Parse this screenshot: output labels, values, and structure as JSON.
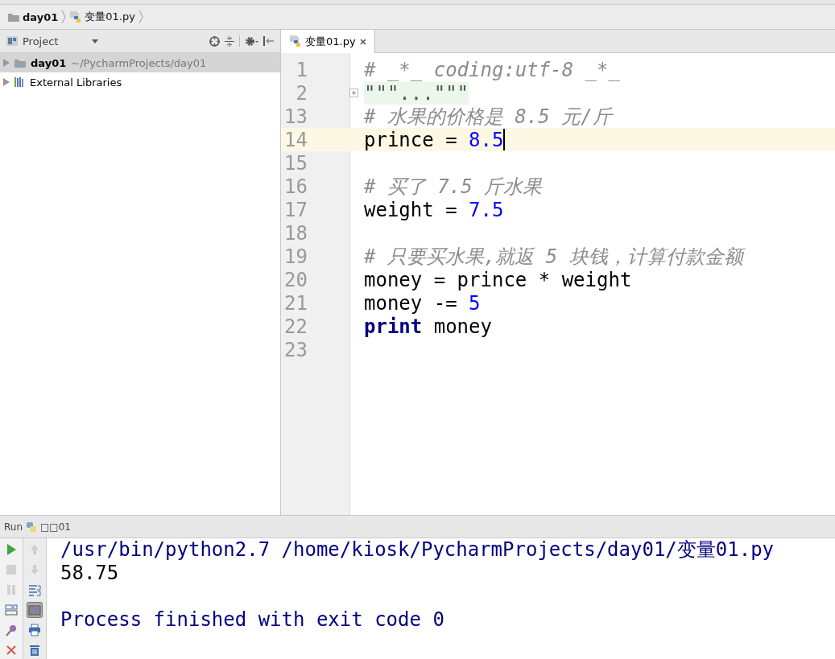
{
  "breadcrumb": [
    {
      "label": "day01",
      "kind": "folder"
    },
    {
      "label": "变量01.py",
      "kind": "python"
    }
  ],
  "project_panel": {
    "title": "Project",
    "tree": [
      {
        "label": "day01",
        "path": "~/PycharmProjects/day01",
        "kind": "folder",
        "selected": true,
        "expanded": false
      },
      {
        "label": "External Libraries",
        "kind": "library",
        "selected": false,
        "expanded": false
      }
    ]
  },
  "editor": {
    "tabs": [
      {
        "label": "变量01.py",
        "selected": true
      }
    ],
    "lines": [
      {
        "number": "1",
        "current": false,
        "tokens": [
          {
            "kind": "comment",
            "text": "# _*_ coding:utf-8 _*_"
          }
        ]
      },
      {
        "number": "2",
        "current": false,
        "folded": true,
        "tokens": [
          {
            "kind": "folded",
            "text": "\"\"\"...\"\"\""
          }
        ]
      },
      {
        "number": "13",
        "current": false,
        "tokens": [
          {
            "kind": "comment",
            "text": "# 水果的价格是 8.5 元/斤"
          }
        ]
      },
      {
        "number": "14",
        "current": true,
        "tokens": [
          {
            "kind": "plain",
            "text": "prince = "
          },
          {
            "kind": "number",
            "text": "8.5"
          }
        ]
      },
      {
        "number": "15",
        "current": false
      },
      {
        "number": "16",
        "current": false,
        "tokens": [
          {
            "kind": "comment",
            "text": "# 买了 7.5 斤水果"
          }
        ]
      },
      {
        "number": "17",
        "current": false,
        "tokens": [
          {
            "kind": "plain",
            "text": "weight = "
          },
          {
            "kind": "number",
            "text": "7.5"
          }
        ]
      },
      {
        "number": "18",
        "current": false
      },
      {
        "number": "19",
        "current": false,
        "tokens": [
          {
            "kind": "comment",
            "text": "# 只要买水果,就返 5 块钱，计算付款金额"
          }
        ]
      },
      {
        "number": "20",
        "current": false,
        "tokens": [
          {
            "kind": "plain",
            "text": "money = prince * weight"
          }
        ]
      },
      {
        "number": "21",
        "current": false,
        "tokens": [
          {
            "kind": "plain",
            "text": "money -= "
          },
          {
            "kind": "number",
            "text": "5"
          }
        ]
      },
      {
        "number": "22",
        "current": false,
        "tokens": [
          {
            "kind": "keyword",
            "text": "print"
          },
          {
            "kind": "plain",
            "text": " money"
          }
        ]
      },
      {
        "number": "23",
        "current": false
      }
    ]
  },
  "run_panel": {
    "label": "Run",
    "config": "□□01",
    "tools_left": [
      {
        "kind": "run",
        "disabled": false
      },
      {
        "kind": "stop",
        "disabled": true
      },
      {
        "kind": "pause",
        "disabled": true
      },
      {
        "kind": "layout",
        "disabled": false
      },
      {
        "kind": "pin",
        "disabled": false
      },
      {
        "kind": "close",
        "disabled": false
      }
    ],
    "tools_right": [
      {
        "kind": "up",
        "disabled": true,
        "pressed": false
      },
      {
        "kind": "down",
        "disabled": true,
        "pressed": false
      },
      {
        "kind": "wrap",
        "disabled": false,
        "pressed": false
      },
      {
        "kind": "scroll-end",
        "disabled": false,
        "pressed": true
      },
      {
        "kind": "print",
        "disabled": false,
        "pressed": false
      },
      {
        "kind": "trash",
        "disabled": false,
        "pressed": false
      }
    ],
    "output": [
      {
        "kind": "command",
        "text": "/usr/bin/python2.7 /home/kiosk/PycharmProjects/day01/变量01.py"
      },
      {
        "kind": "stdout",
        "text": "58.75"
      },
      {
        "kind": "system",
        "text": "Process finished with exit code 0"
      }
    ]
  }
}
